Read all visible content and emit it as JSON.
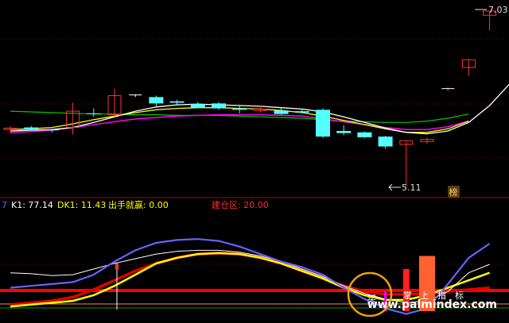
{
  "main_panel": {
    "high_label": "7.03",
    "low_label": "5.11",
    "badge": "榜"
  },
  "indicator_panel": {
    "prefix": "7",
    "k1": "K1: 77.14",
    "dk1": "DK1: 11.43",
    "signal": "出手就赢: 0.00",
    "zone": "建仓区: 20.00",
    "annotations": [
      "买",
      "掌",
      "上",
      "指",
      "标"
    ]
  },
  "watermark": "www.palmindex.com",
  "colors": {
    "background": "#000000",
    "up_candle": "#ff3232",
    "down_candle": "#54ffff",
    "ma_white": "#ffffff",
    "ma_yellow": "#ffff00",
    "ma_magenta": "#ff00ff",
    "ma_green": "#00c800",
    "k_line": "#6464ff",
    "red_line": "#ff0000",
    "grid": "#8b0000",
    "circle": "#f0a000"
  },
  "chart_data": {
    "type": "candlestick",
    "candles": [
      {
        "o": 5.92,
        "h": 5.97,
        "l": 5.86,
        "c": 5.94
      },
      {
        "o": 5.95,
        "h": 5.97,
        "l": 5.9,
        "c": 5.92
      },
      {
        "o": 5.92,
        "h": 5.93,
        "l": 5.88,
        "c": 5.91
      },
      {
        "o": 5.95,
        "h": 6.3,
        "l": 5.85,
        "c": 6.18
      },
      {
        "o": 6.15,
        "h": 6.22,
        "l": 6.1,
        "c": 6.14
      },
      {
        "o": 6.13,
        "h": 6.5,
        "l": 6.08,
        "c": 6.4
      },
      {
        "o": 6.4,
        "h": 6.42,
        "l": 6.38,
        "c": 6.41
      },
      {
        "o": 6.38,
        "h": 6.4,
        "l": 6.25,
        "c": 6.29
      },
      {
        "o": 6.32,
        "h": 6.34,
        "l": 6.26,
        "c": 6.3
      },
      {
        "o": 6.28,
        "h": 6.31,
        "l": 6.22,
        "c": 6.23
      },
      {
        "o": 6.29,
        "h": 6.31,
        "l": 6.2,
        "c": 6.22
      },
      {
        "o": 6.22,
        "h": 6.26,
        "l": 6.15,
        "c": 6.2
      },
      {
        "o": 6.19,
        "h": 6.25,
        "l": 6.16,
        "c": 6.21
      },
      {
        "o": 6.19,
        "h": 6.22,
        "l": 6.13,
        "c": 6.14
      },
      {
        "o": 6.18,
        "h": 6.21,
        "l": 6.15,
        "c": 6.16
      },
      {
        "o": 6.2,
        "h": 6.22,
        "l": 5.8,
        "c": 5.82
      },
      {
        "o": 5.9,
        "h": 5.98,
        "l": 5.84,
        "c": 5.87
      },
      {
        "o": 5.88,
        "h": 5.89,
        "l": 5.8,
        "c": 5.81
      },
      {
        "o": 5.82,
        "h": 5.83,
        "l": 5.65,
        "c": 5.68
      },
      {
        "o": 5.71,
        "h": 5.75,
        "l": 5.11,
        "c": 5.76
      },
      {
        "o": 5.75,
        "h": 5.8,
        "l": 5.72,
        "c": 5.78
      },
      {
        "o": 6.48,
        "h": 6.52,
        "l": 6.46,
        "c": 6.5
      },
      {
        "o": 6.8,
        "h": 6.91,
        "l": 6.68,
        "c": 6.91
      },
      {
        "o": 7.54,
        "h": 7.6,
        "l": 7.32,
        "c": 7.6
      }
    ],
    "ma_white": [
      5.9,
      5.91,
      5.92,
      5.95,
      6.02,
      6.1,
      6.18,
      6.24,
      6.27,
      6.28,
      6.27,
      6.26,
      6.25,
      6.23,
      6.21,
      6.17,
      6.1,
      6.02,
      5.94,
      5.88,
      5.86,
      5.9,
      6.02,
      6.26,
      6.58
    ],
    "ma_yellow": [
      5.92,
      5.93,
      5.95,
      6.0,
      6.06,
      6.11,
      6.16,
      6.2,
      6.22,
      6.23,
      6.23,
      6.22,
      6.21,
      6.19,
      6.16,
      6.11,
      6.05,
      5.99,
      5.93,
      5.88,
      5.88,
      5.93,
      6.04
    ],
    "ma_magenta": [
      5.88,
      5.89,
      5.91,
      5.95,
      5.99,
      6.03,
      6.07,
      6.09,
      6.11,
      6.12,
      6.13,
      6.13,
      6.13,
      6.12,
      6.11,
      6.07,
      6.03,
      5.99,
      5.95,
      5.92,
      5.92,
      5.96,
      6.04
    ],
    "ma_green": [
      6.18,
      6.17,
      6.16,
      6.15,
      6.14,
      6.14,
      6.13,
      6.13,
      6.12,
      6.12,
      6.12,
      6.11,
      6.1,
      6.09,
      6.08,
      6.06,
      6.04,
      6.03,
      6.02,
      6.02,
      6.04,
      6.08,
      6.14
    ],
    "k1": [
      30,
      32,
      34,
      36,
      44,
      58,
      70,
      78,
      81,
      82,
      80,
      74,
      66,
      58,
      52,
      44,
      30,
      18,
      8,
      2,
      8,
      34,
      62,
      77.14
    ],
    "dk1": [
      46,
      45,
      43,
      44,
      50,
      56,
      61,
      66,
      69,
      70,
      70,
      68,
      64,
      58,
      50,
      42,
      32,
      24,
      18,
      14,
      16,
      26,
      46,
      55
    ],
    "yellow_line": [
      10,
      12,
      14,
      16,
      22,
      32,
      44,
      56,
      62,
      66,
      67,
      66,
      62,
      56,
      48,
      40,
      30,
      22,
      17,
      17,
      22,
      30,
      38,
      46
    ],
    "red_curve": [
      12,
      14,
      16,
      20,
      28,
      38,
      48,
      56,
      62,
      66,
      67,
      66,
      62,
      56,
      48,
      40,
      32,
      26,
      23,
      23,
      24,
      26,
      28,
      30
    ],
    "buy_bars": [
      {
        "i": 18,
        "v": 26
      },
      {
        "i": 19,
        "v": 50
      },
      {
        "i": 20,
        "v": 64
      }
    ]
  }
}
